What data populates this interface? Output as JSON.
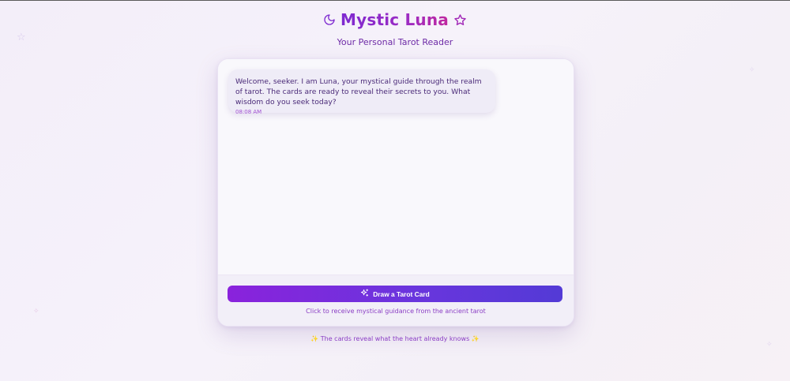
{
  "header": {
    "title": "Mystic Luna",
    "subtitle": "Your Personal Tarot Reader",
    "left_icon": "crescent-moon-icon",
    "right_icon": "star-outline-icon"
  },
  "chat": {
    "messages": [
      {
        "text": "Welcome, seeker. I am Luna, your mystical guide through the realm of tarot. The cards are ready to reveal their secrets to you. What wisdom do you seek today?",
        "time": "08:08 AM"
      }
    ]
  },
  "actions": {
    "draw_button_label": "Draw a Tarot Card",
    "draw_button_icon": "sparkles-icon",
    "hint": "Click to receive mystical guidance from the ancient tarot"
  },
  "footer": {
    "tagline": "✨ The cards reveal what the heart already knows ✨"
  },
  "colors": {
    "accent_purple": "#7e2ad0",
    "accent_magenta": "#c0289f",
    "button_start": "#8a22dc",
    "button_end": "#533ad6",
    "text_purple": "#6d2aa6"
  }
}
